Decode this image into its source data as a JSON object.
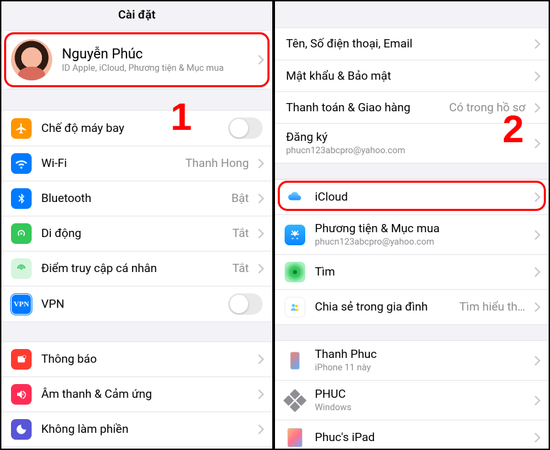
{
  "left": {
    "title": "Cài đặt",
    "annNumber": "1",
    "profile": {
      "name": "Nguyễn Phúc",
      "subtitle": "ID Apple, iCloud, Phương tiện & Mục mua"
    },
    "group1": {
      "airplane": {
        "label": "Chế độ máy bay"
      },
      "wifi": {
        "label": "Wi-Fi",
        "value": "Thanh Hong"
      },
      "bt": {
        "label": "Bluetooth",
        "value": "Bật"
      },
      "cell": {
        "label": "Di động",
        "value": "Tắt"
      },
      "hotspot": {
        "label": "Điểm truy cập cá nhân",
        "value": "Tắt"
      },
      "vpn": {
        "label": "VPN"
      }
    },
    "group2": {
      "notif": {
        "label": "Thông báo"
      },
      "sound": {
        "label": "Âm thanh & Cảm ứng"
      },
      "dnd": {
        "label": "Không làm phiền"
      }
    }
  },
  "right": {
    "annNumber": "2",
    "groupA": {
      "contact": {
        "label": "Tên, Số điện thoại, Email"
      },
      "secure": {
        "label": "Mật khẩu & Bảo mật"
      },
      "pay": {
        "label": "Thanh toán & Giao hàng",
        "value": "Có trong hồ sơ"
      },
      "sub": {
        "label": "Đăng ký",
        "detail": "phucn123abcpro@yahoo.com"
      }
    },
    "groupB": {
      "icloud": {
        "label": "iCloud"
      },
      "media": {
        "label": "Phương tiện & Mục mua",
        "detail": "phucn123abcpro@yahoo.com"
      },
      "find": {
        "label": "Tìm"
      },
      "family": {
        "label": "Chia sẻ trong gia đình",
        "value": "Tìm hiểu th…"
      }
    },
    "devices": {
      "d1": {
        "name": "Thanh Phuc",
        "info": "iPhone 11 này"
      },
      "d2": {
        "name": "PHUC",
        "info": "Windows"
      },
      "d3": {
        "name": "Phuc's iPad"
      }
    }
  }
}
